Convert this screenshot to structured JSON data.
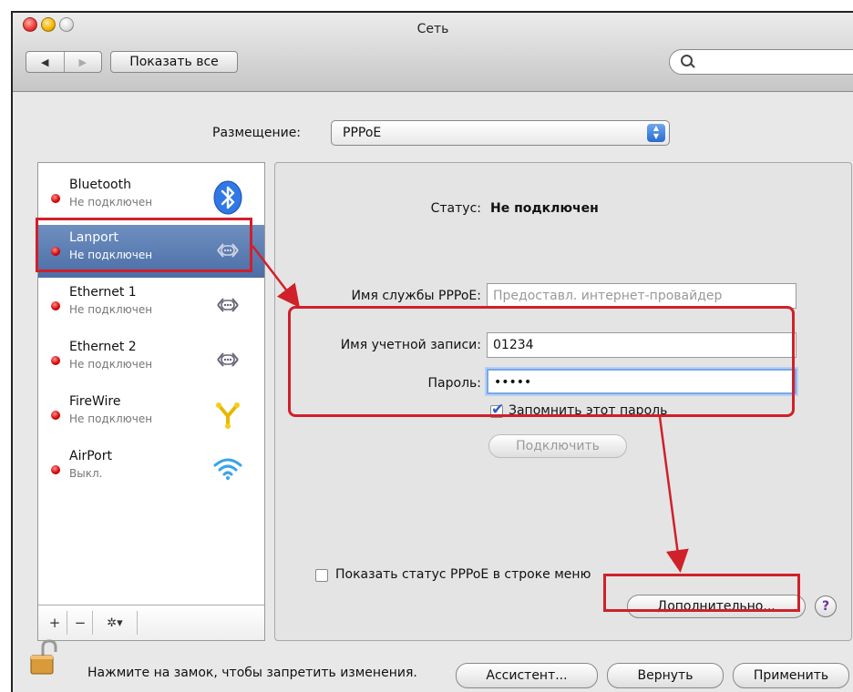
{
  "window": {
    "title": "Сеть"
  },
  "toolbar": {
    "back": "◀",
    "forward": "▶",
    "show_all": "Показать все",
    "search_placeholder": ""
  },
  "location": {
    "label": "Размещение:",
    "value": "PPPoE"
  },
  "services": [
    {
      "name": "Bluetooth",
      "status": "Не подключен",
      "icon": "bluetooth-icon"
    },
    {
      "name": "Lanport",
      "status": "Не подключен",
      "icon": "ethernet-icon"
    },
    {
      "name": "Ethernet 1",
      "status": "Не подключен",
      "icon": "ethernet-icon"
    },
    {
      "name": "Ethernet 2",
      "status": "Не подключен",
      "icon": "ethernet-icon"
    },
    {
      "name": "FireWire",
      "status": "Не подключен",
      "icon": "firewire-icon"
    },
    {
      "name": "AirPort",
      "status": "Выкл.",
      "icon": "wifi-icon"
    }
  ],
  "list_toolbar": {
    "add": "+",
    "remove": "−",
    "gear": "✲▾"
  },
  "details": {
    "status_label": "Статус:",
    "status_value": "Не подключен",
    "service_name_label": "Имя службы PPPoE:",
    "service_name_placeholder": "Предоставл. интернет-провайдер",
    "account_label": "Имя учетной записи:",
    "account_value": "01234",
    "password_label": "Пароль:",
    "password_value": "•••••",
    "remember_label": "Запомнить этот пароль",
    "remember_checked": true,
    "connect_button": "Подключить",
    "show_status_label": "Показать статус PPPoE в строке меню",
    "show_status_checked": false,
    "advanced_button": "Дополнительно...",
    "help_button": "?"
  },
  "footer": {
    "lock_text": "Нажмите на замок, чтобы запретить изменения.",
    "assistant_button": "Ассистент...",
    "revert_button": "Вернуть",
    "apply_button": "Применить"
  },
  "colors": {
    "highlight": "#d0202a",
    "selection": "#4b6ea7",
    "status_dot": "#d40000"
  }
}
